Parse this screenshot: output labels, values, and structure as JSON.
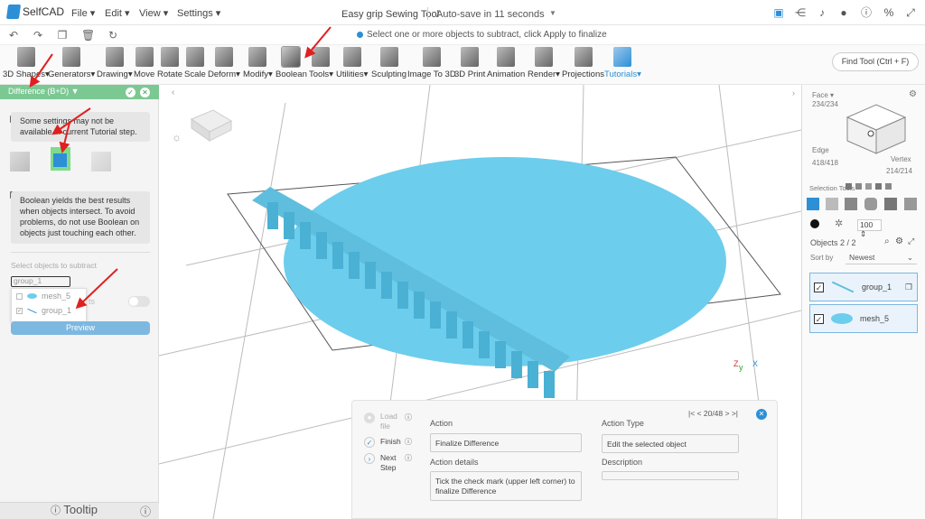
{
  "app": {
    "name": "SelfCAD",
    "file_title": "Easy grip Sewing Tool",
    "autosave": "Auto-save in 11 seconds"
  },
  "menu": [
    "File",
    "Edit",
    "View",
    "Settings"
  ],
  "hint": "Select one or more objects to subtract, click Apply to finalize",
  "toolbar": [
    "3D Shapes",
    "Generators",
    "Drawing",
    "Move",
    "Rotate",
    "Scale",
    "Deform",
    "Modify",
    "Boolean",
    "Tools",
    "Utilities",
    "Sculpting",
    "Image To 3D",
    "3D Print",
    "Animation",
    "Render",
    "Projections",
    "Tutorials"
  ],
  "find_tool": "Find Tool (Ctrl + F)",
  "left_panel": {
    "header": "Difference (B+D)",
    "info1": "Some settings may not be available in current Tutorial step.",
    "info2": "Boolean yields the best results when objects intersect. To avoid problems, do not use Boolean on objects just touching each other.",
    "select_label": "Select objects to subtract",
    "select_value": "group_1",
    "options": [
      {
        "label": "mesh_5",
        "checked": false
      },
      {
        "label": "group_1",
        "checked": true
      }
    ],
    "toggle_label_tail": "ts",
    "preview": "Preview",
    "tooltip": "Tooltip"
  },
  "right_panel": {
    "face_label": "Face",
    "face_count": "234/234",
    "edge_label": "Edge",
    "edge_count": "418/418",
    "vertex_label": "Vertex",
    "vertex_count": "214/214",
    "selection_tools": "Selection Tools",
    "size": "100",
    "objects": "Objects 2 / 2",
    "sort_by": "Sort by",
    "sort_value": "Newest",
    "items": [
      {
        "name": "group_1"
      },
      {
        "name": "mesh_5"
      }
    ]
  },
  "bottom_panel": {
    "steps": [
      {
        "label": "Load file"
      },
      {
        "label": "Finish"
      },
      {
        "label": "Next Step"
      }
    ],
    "pager": "20/48",
    "action_label": "Action",
    "action_value": "Finalize Difference",
    "action_type_label": "Action Type",
    "action_type_value": "Edit the selected object",
    "details_label": "Action details",
    "details_value": "Tick the check mark (upper left corner) to finalize Difference",
    "description_label": "Description",
    "description_value": ""
  },
  "colors": {
    "accent": "#2d8fd6",
    "panel_header": "#7cc893",
    "model": "#6dcdec",
    "arrow": "#e02020"
  }
}
